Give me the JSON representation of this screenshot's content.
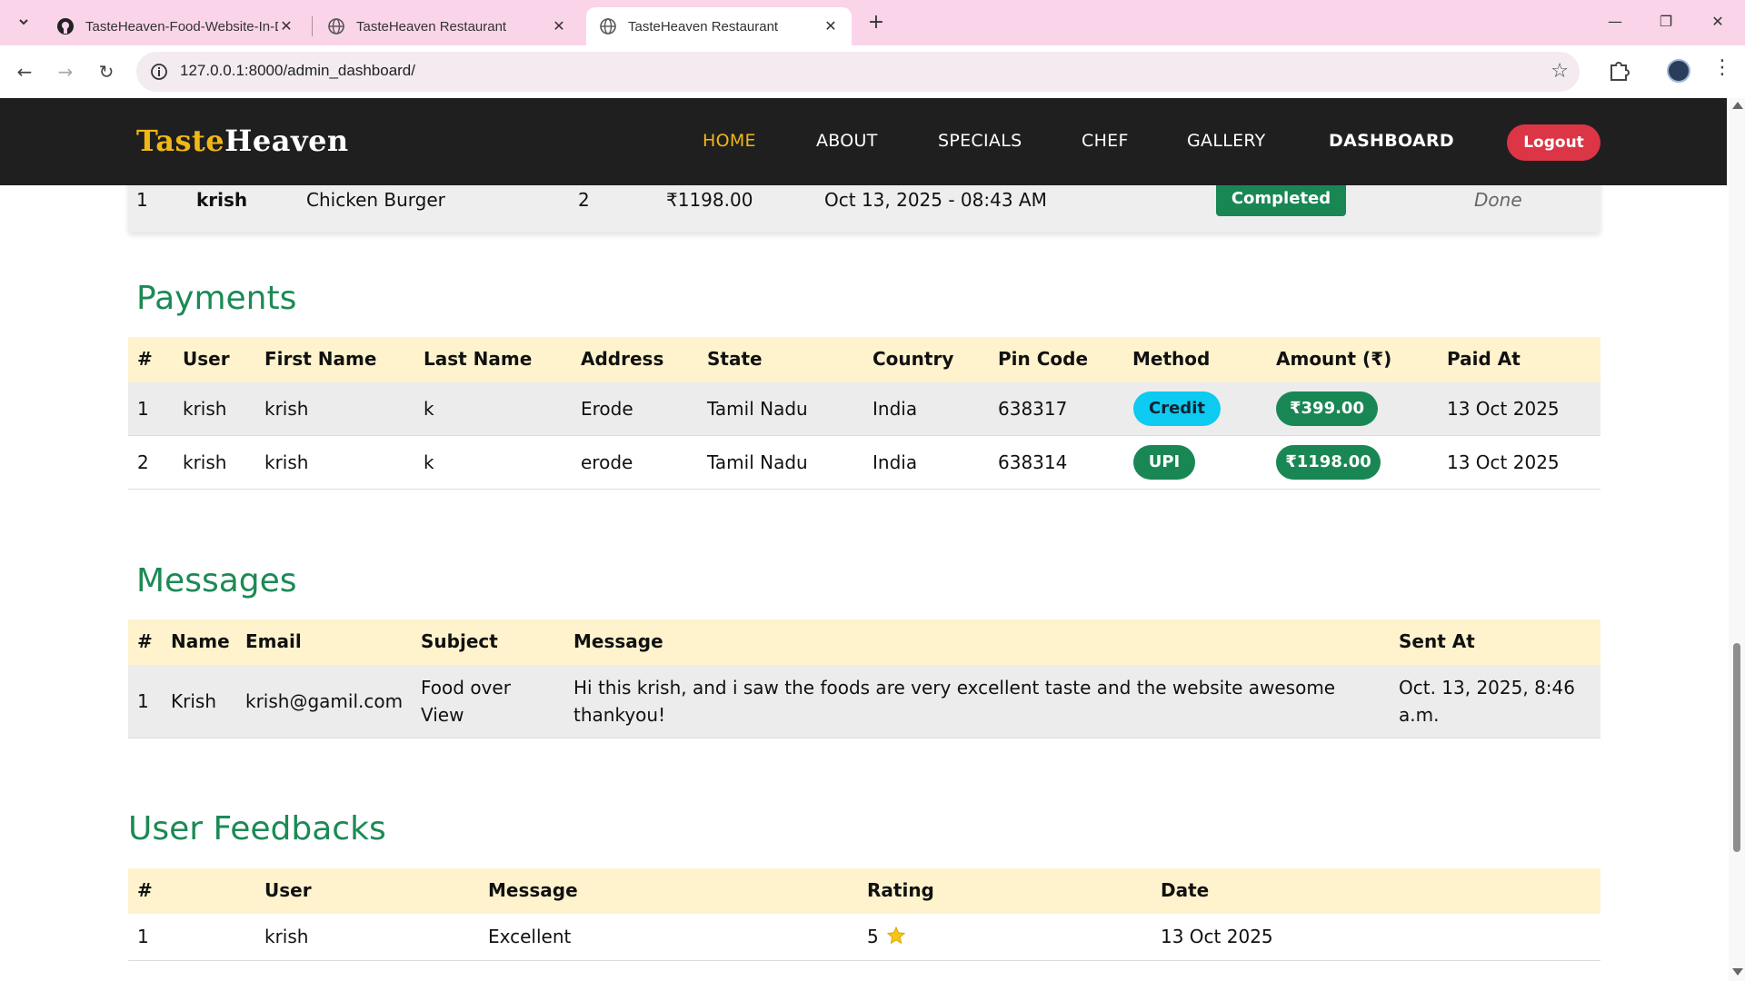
{
  "browser": {
    "tabs": [
      {
        "title": "TasteHeaven-Food-Website-In-Dj",
        "active": false
      },
      {
        "title": "TasteHeaven Restaurant",
        "active": false
      },
      {
        "title": "TasteHeaven Restaurant",
        "active": true
      }
    ],
    "url": "127.0.0.1:8000/admin_dashboard/"
  },
  "site": {
    "logo_part1": "Taste",
    "logo_part2": "Heaven",
    "nav": [
      "HOME",
      "ABOUT",
      "SPECIALS",
      "CHEF",
      "GALLERY",
      "DASHBOARD"
    ],
    "logout_label": "Logout"
  },
  "orders_row": {
    "index": "1",
    "user": "krish",
    "item": "Chicken Burger",
    "qty": "2",
    "total": "₹1198.00",
    "ordered_at": "Oct 13, 2025 - 08:43 AM",
    "status": "Completed",
    "action": "Done"
  },
  "payments": {
    "title": "Payments",
    "headers": [
      "#",
      "User",
      "First Name",
      "Last Name",
      "Address",
      "State",
      "Country",
      "Pin Code",
      "Method",
      "Amount (₹)",
      "Paid At"
    ],
    "rows": [
      [
        "1",
        "krish",
        "krish",
        "k",
        "Erode",
        "Tamil Nadu",
        "India",
        "638317",
        "Credit",
        "₹399.00",
        "13 Oct 2025"
      ],
      [
        "2",
        "krish",
        "krish",
        "k",
        "erode",
        "Tamil Nadu",
        "India",
        "638314",
        "UPI",
        "₹1198.00",
        "13 Oct 2025"
      ]
    ]
  },
  "messages": {
    "title": "Messages",
    "headers": [
      "#",
      "Name",
      "Email",
      "Subject",
      "Message",
      "Sent At"
    ],
    "rows": [
      [
        "1",
        "Krish",
        "krish@gamil.com",
        "Food over View",
        "Hi this krish, and i saw the foods are very excellent taste and the website awesome thankyou!",
        "Oct. 13, 2025, 8:46 a.m."
      ]
    ]
  },
  "feedbacks": {
    "title": "User Feedbacks",
    "headers": [
      "#",
      "User",
      "Message",
      "Rating",
      "Date"
    ],
    "rows": [
      [
        "1",
        "krish",
        "Excellent",
        "5",
        "13 Oct 2025"
      ]
    ]
  },
  "colors": {
    "brand_gold": "#f0b816",
    "heading_green": "#1b8a55",
    "badge_green": "#198754",
    "credit_cyan": "#0dcaf0",
    "logout_red": "#dc3545",
    "table_header": "#fff3cd",
    "tabstrip_pink": "#fad4e9"
  }
}
